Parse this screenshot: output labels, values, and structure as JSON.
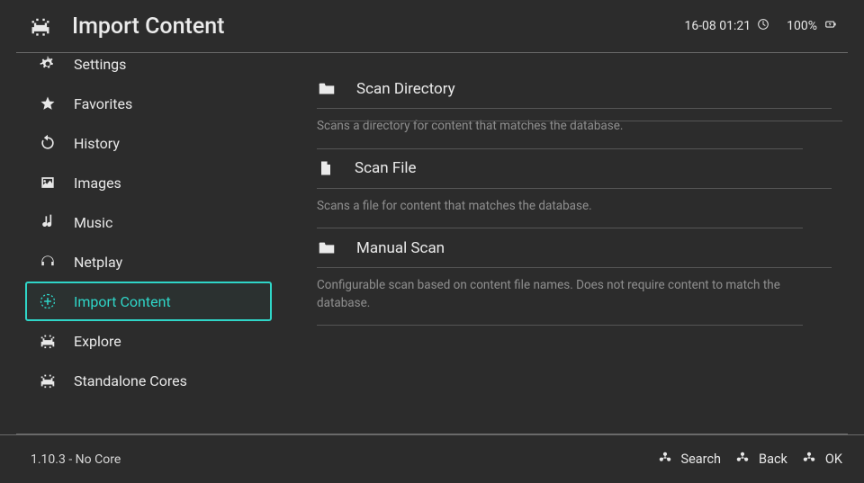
{
  "header": {
    "title": "Import Content",
    "datetime": "16-08 01:21",
    "battery_text": "100%"
  },
  "sidebar": {
    "items": [
      {
        "icon": "gear",
        "label": "Settings"
      },
      {
        "icon": "star",
        "label": "Favorites"
      },
      {
        "icon": "history",
        "label": "History"
      },
      {
        "icon": "image",
        "label": "Images"
      },
      {
        "icon": "music",
        "label": "Music"
      },
      {
        "icon": "headphones",
        "label": "Netplay"
      },
      {
        "icon": "plus",
        "label": "Import Content",
        "active": true
      },
      {
        "icon": "invader",
        "label": "Explore"
      },
      {
        "icon": "invader",
        "label": "Standalone Cores"
      }
    ]
  },
  "content": {
    "items": [
      {
        "icon": "folder",
        "label": "Scan Directory",
        "description": "Scans a directory for content that matches the database."
      },
      {
        "icon": "file",
        "label": "Scan File",
        "description": "Scans a file for content that matches the database."
      },
      {
        "icon": "folder",
        "label": "Manual Scan",
        "description": "Configurable scan based on content file names. Does not require content to match the database."
      }
    ]
  },
  "footer": {
    "version": "1.10.3 - No Core",
    "actions": [
      {
        "label": "Search"
      },
      {
        "label": "Back"
      },
      {
        "label": "OK"
      }
    ]
  }
}
